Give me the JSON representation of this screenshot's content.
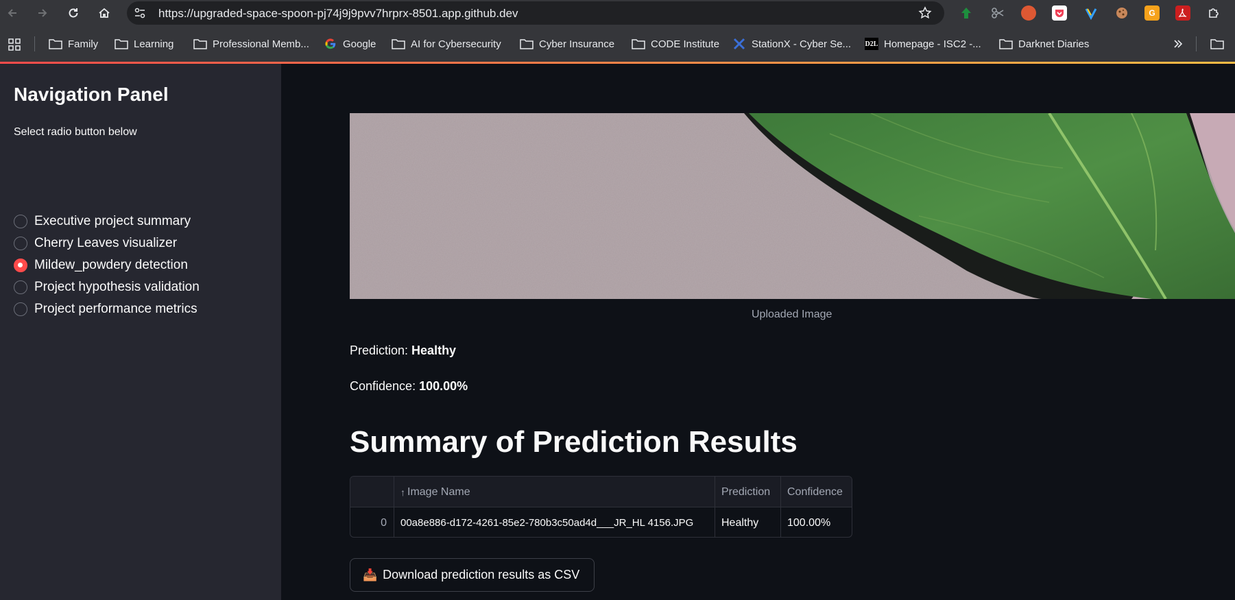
{
  "browser": {
    "url": "https://upgraded-space-spoon-pj74j9j9pvv7hrprx-8501.app.github.dev",
    "bookmarks": [
      {
        "label": "Family",
        "icon": "folder-icon"
      },
      {
        "label": "Learning",
        "icon": "folder-icon"
      },
      {
        "label": "Professional Memb...",
        "icon": "folder-icon"
      },
      {
        "label": "Google",
        "icon": "google-icon"
      },
      {
        "label": "AI for Cybersecurity",
        "icon": "folder-icon"
      },
      {
        "label": "Cyber Insurance",
        "icon": "folder-icon"
      },
      {
        "label": "CODE Institute",
        "icon": "folder-icon"
      },
      {
        "label": "StationX - Cyber Se...",
        "icon": "stationx-icon"
      },
      {
        "label": "Homepage - ISC2 -...",
        "icon": "d2l-icon"
      },
      {
        "label": "Darknet Diaries",
        "icon": "folder-icon"
      }
    ],
    "d2l_text": "D2L"
  },
  "sidebar": {
    "title": "Navigation Panel",
    "subtitle": "Select radio button below",
    "options": [
      {
        "label": "Executive project summary",
        "checked": false
      },
      {
        "label": "Cherry Leaves visualizer",
        "checked": false
      },
      {
        "label": "Mildew_powdery detection",
        "checked": true
      },
      {
        "label": "Project hypothesis validation",
        "checked": false
      },
      {
        "label": "Project performance metrics",
        "checked": false
      }
    ]
  },
  "main": {
    "image_caption": "Uploaded Image",
    "prediction_label": "Prediction: ",
    "prediction_value": "Healthy",
    "confidence_label": "Confidence: ",
    "confidence_value": "100.00%",
    "summary_title": "Summary of Prediction Results",
    "table": {
      "headers": [
        "",
        "Image Name",
        "Prediction",
        "Confidence"
      ],
      "sort_indicator": "↑",
      "rows": [
        [
          "0",
          "00a8e886-d172-4261-85e2-780b3c50ad4d___JR_HL 4156.JPG",
          "Healthy",
          "100.00%"
        ]
      ]
    },
    "download_button": "Download prediction results as CSV",
    "download_icon": "📥"
  },
  "colors": {
    "accent": "#ff4b4b",
    "sidebar_bg": "#262730",
    "main_bg": "#0e1117"
  }
}
